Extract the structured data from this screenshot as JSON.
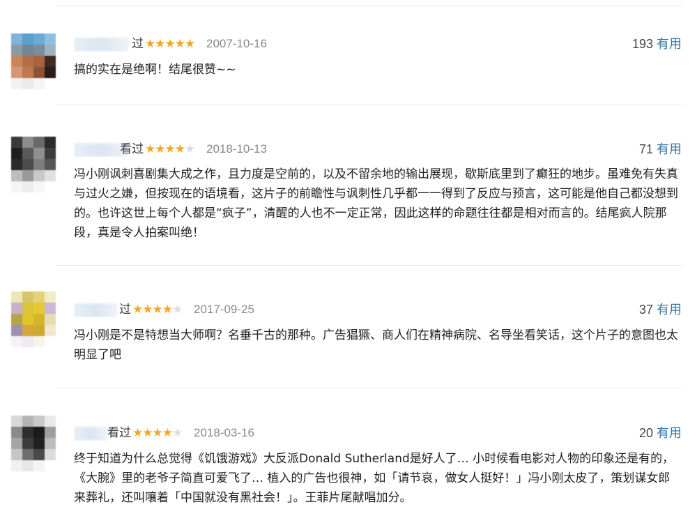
{
  "comments": [
    {
      "user_tail": "过",
      "rating": 5,
      "stars_text": "★★★★★",
      "stars_off": "",
      "date": "2007-10-16",
      "votes": "193",
      "useful_label": "有用",
      "text": "搞的实在是绝啊！结尾很赞~~"
    },
    {
      "user_tail": "看过",
      "rating": 4,
      "stars_text": "★★★★",
      "stars_off": "★",
      "date": "2018-10-13",
      "votes": "71",
      "useful_label": "有用",
      "text": "冯小刚讽刺喜剧集大成之作，且力度是空前的，以及不留余地的输出展现，歇斯底里到了癫狂的地步。虽难免有失真与过火之嫌，但按现在的语境看，这片子的前瞻性与讽刺性几乎都一一得到了反应与预言，这可能是他自己都没想到的。也许这世上每个人都是“疯子”，清醒的人也不一定正常，因此这样的命题往往都是相对而言的。结尾疯人院那段，真是令人拍案叫绝！"
    },
    {
      "user_tail": "过",
      "rating": 4,
      "stars_text": "★★★★",
      "stars_off": "★",
      "date": "2017-09-25",
      "votes": "37",
      "useful_label": "有用",
      "text": "冯小刚是不是特想当大师啊？名垂千古的那种。广告猖獗、商人们在精神病院、名导坐看笑话，这个片子的意图也太明显了吧"
    },
    {
      "user_tail": "看过",
      "rating": 4,
      "stars_text": "★★★★",
      "stars_off": "★",
      "date": "2018-03-16",
      "votes": "20",
      "useful_label": "有用",
      "text": "终于知道为什么总觉得《饥饿游戏》大反派Donald Sutherland是好人了… 小时候看电影对人物的印象还是有的，《大腕》里的老爷子简直可爱飞了… 植入的广告也很神，如「请节哀，做女人挺好！」冯小刚太皮了，策划谋女郎来葬礼，还叫嚷着「中国就没有黑社会！」。王菲片尾献唱加分。"
    }
  ]
}
